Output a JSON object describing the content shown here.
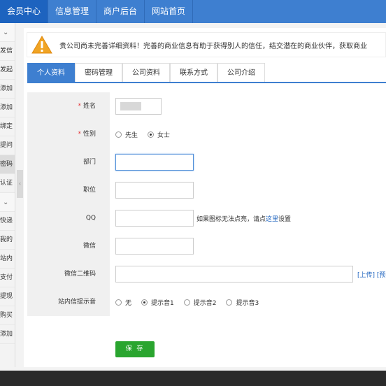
{
  "topnav": {
    "items": [
      {
        "label": "会员中心",
        "active": true
      },
      {
        "label": "信息管理",
        "active": false
      },
      {
        "label": "商户后台",
        "active": false
      },
      {
        "label": "网站首页",
        "active": false
      }
    ]
  },
  "sidebar": {
    "items": [
      {
        "label": "⌄",
        "type": "section"
      },
      {
        "label": "发信",
        "type": "item"
      },
      {
        "label": "发起",
        "type": "item"
      },
      {
        "label": "添加",
        "type": "item"
      },
      {
        "label": "添加",
        "type": "item"
      },
      {
        "label": "绑定",
        "type": "item"
      },
      {
        "label": "提问",
        "type": "item"
      },
      {
        "label": "密码",
        "type": "item",
        "active": true
      },
      {
        "label": "认证",
        "type": "item"
      },
      {
        "label": "⌄",
        "type": "section"
      },
      {
        "label": "快递",
        "type": "item"
      },
      {
        "label": "我的",
        "type": "item"
      },
      {
        "label": "站内",
        "type": "item"
      },
      {
        "label": "支付",
        "type": "item"
      },
      {
        "label": "提现",
        "type": "item"
      },
      {
        "label": "购买",
        "type": "item"
      },
      {
        "label": "添加",
        "type": "item"
      }
    ]
  },
  "notice": {
    "text": "贵公司尚未完善详细资料！完善的商业信息有助于获得别人的信任，结交潜在的商业伙伴，获取商业"
  },
  "tabs": [
    {
      "label": "个人资料",
      "active": true
    },
    {
      "label": "密码管理",
      "active": false
    },
    {
      "label": "公司资料",
      "active": false
    },
    {
      "label": "联系方式",
      "active": false
    },
    {
      "label": "公司介绍",
      "active": false
    }
  ],
  "form": {
    "name_label": "姓名",
    "gender_label": "性别",
    "gender_options": [
      "先生",
      "女士"
    ],
    "gender_selected": "女士",
    "dept_label": "部门",
    "position_label": "职位",
    "qq_label": "QQ",
    "qq_hint_prefix": "如果图标无法点亮，请点",
    "qq_hint_link": "这里",
    "qq_hint_suffix": "设置",
    "wechat_label": "微信",
    "wechat_qr_label": "微信二维码",
    "wechat_qr_links": "[上传]  [预",
    "notify_label": "站内信提示音",
    "notify_options": [
      "无",
      "提示音1",
      "提示音2",
      "提示音3"
    ],
    "notify_selected": "提示音1",
    "save_label": "保 存"
  },
  "colors": {
    "nav_blue": "#3e7fd0",
    "save_green": "#2aa52f",
    "required_red": "#e4393c"
  }
}
